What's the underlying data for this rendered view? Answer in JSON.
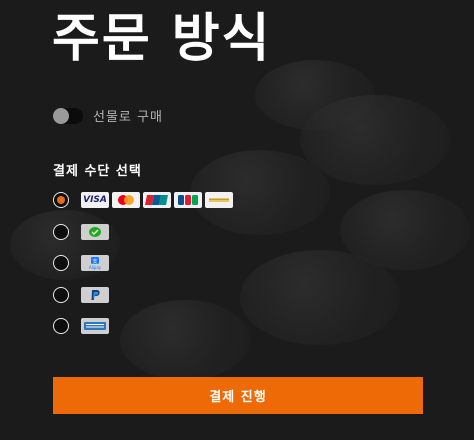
{
  "page": {
    "title": "주문 방식"
  },
  "gift": {
    "label": "선물로 구매",
    "enabled": false
  },
  "payment": {
    "section_label": "결제 수단 선택",
    "methods": [
      {
        "id": "cards",
        "selected": true,
        "logos": [
          "VISA",
          "mastercard-icon",
          "unionpay-icon",
          "jcb-icon",
          "union-generic-icon"
        ]
      },
      {
        "id": "wechat",
        "selected": false,
        "logos": [
          "wechat-pay-icon"
        ]
      },
      {
        "id": "alipay",
        "selected": false,
        "logos": [
          "alipay-icon"
        ]
      },
      {
        "id": "paypal",
        "selected": false,
        "logos": [
          "paypal-icon"
        ]
      },
      {
        "id": "amex",
        "selected": false,
        "logos": [
          "amex-icon"
        ]
      }
    ],
    "visa_text": "VISA",
    "alipay_text": "Alipay"
  },
  "submit": {
    "label": "결제 진행"
  },
  "colors": {
    "background": "#1b1b1b",
    "accent": "#ee6a07",
    "radio_checked": "#e86a1a"
  }
}
